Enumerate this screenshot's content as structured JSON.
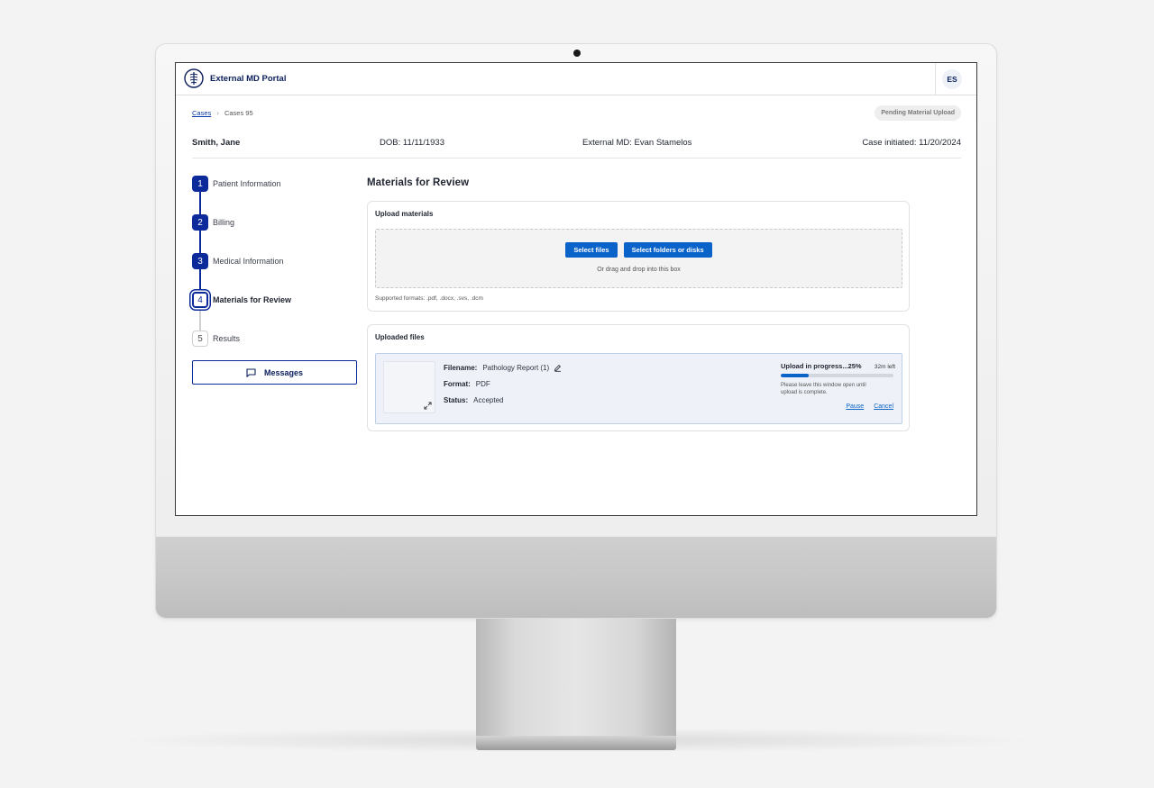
{
  "header": {
    "portal_title": "External MD Portal",
    "user_initials": "ES"
  },
  "breadcrumb": {
    "root_label": "Cases",
    "current_label": "Cases 95"
  },
  "case_status": "Pending Material Upload",
  "patient": {
    "name": "Smith, Jane",
    "dob": "DOB: 11/11/1933",
    "external_md": "External MD: Evan Stamelos",
    "case_initiated": "Case initiated: 11/20/2024"
  },
  "steps": [
    {
      "number": "1",
      "label": "Patient Information",
      "state": "completed"
    },
    {
      "number": "2",
      "label": "Billing",
      "state": "completed"
    },
    {
      "number": "3",
      "label": "Medical Information",
      "state": "completed"
    },
    {
      "number": "4",
      "label": "Materials for Review",
      "state": "current"
    },
    {
      "number": "5",
      "label": "Results",
      "state": "upcoming"
    }
  ],
  "messages_label": "Messages",
  "main": {
    "title": "Materials for Review",
    "upload": {
      "title": "Upload materials",
      "select_files_label": "Select files",
      "select_folders_label": "Select folders or disks",
      "drop_hint": "Or drag and drop into this box",
      "supported_formats": "Supported formats: .pdf, .docx, .svs, .dcm"
    },
    "uploaded": {
      "title": "Uploaded files",
      "file": {
        "filename_label": "Filename:",
        "filename": "Pathology Report (1)",
        "format_label": "Format:",
        "format": "PDF",
        "status_label": "Status:",
        "status": "Accepted",
        "progress_text": "Upload in progress...25%",
        "progress_fraction": 0.25,
        "time_left": "32m left",
        "progress_note": "Please leave this window open until upload is complete.",
        "pause_label": "Pause",
        "cancel_label": "Cancel"
      }
    }
  },
  "colors": {
    "brand_navy": "#0d2a9a",
    "primary_button": "#0a63c9",
    "status_pill_bg": "#eeeeee"
  },
  "icons": {
    "logo": "shield-spine-logo-icon",
    "messages": "chat-bubble-icon",
    "edit": "pencil-icon",
    "expand": "expand-arrows-icon",
    "breadcrumb_separator": "chevron-right-icon"
  }
}
